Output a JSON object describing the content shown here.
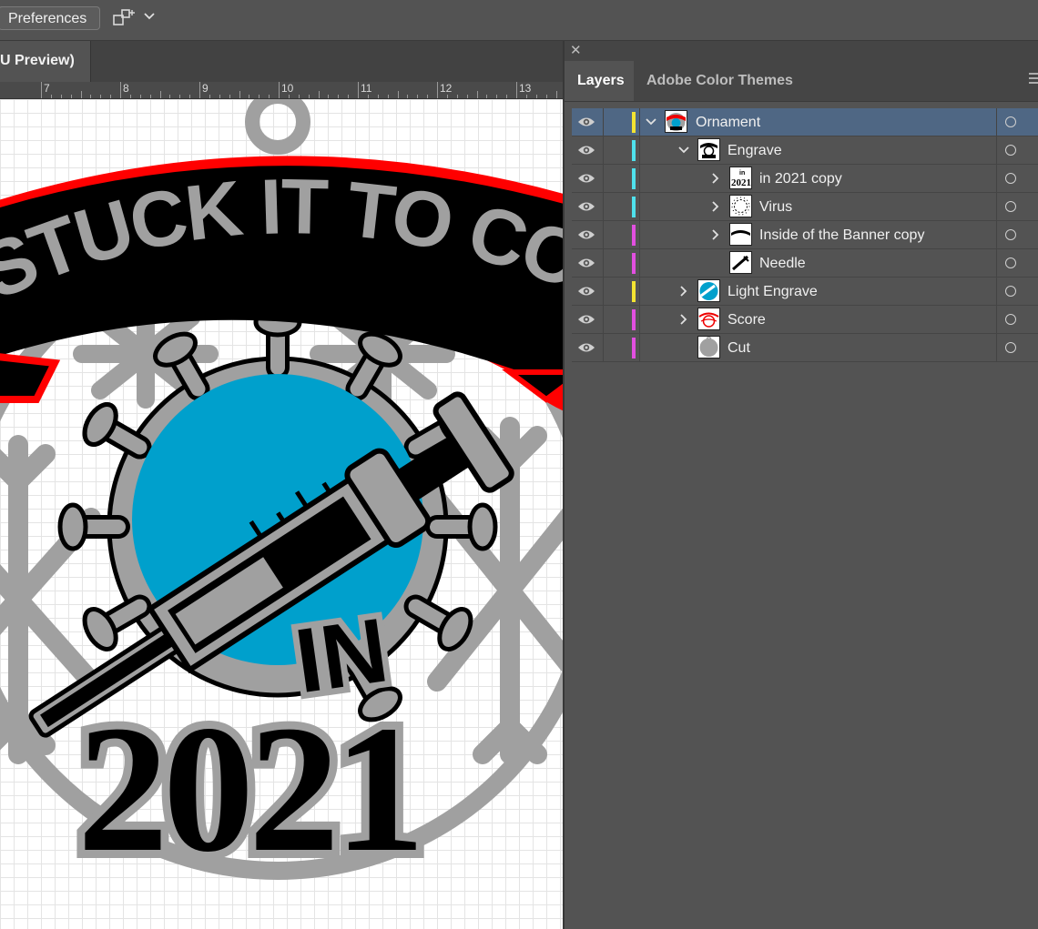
{
  "toolbar": {
    "preferences_label": "Preferences",
    "arrange_icon": "arrange-documents-icon",
    "dropdown_icon": "chevron-down-icon"
  },
  "document": {
    "tab_label": "U Preview)"
  },
  "ruler": {
    "labels": [
      "7",
      "8",
      "9",
      "10",
      "11",
      "12",
      "13"
    ]
  },
  "artwork": {
    "banner_text": "STUCK IT TO COVID",
    "in_text": "IN",
    "year_text": "2021",
    "colors": {
      "banner_red": "#ff0000",
      "banner_black": "#000000",
      "gray": "#a0a0a0",
      "circle_blue": "#00a0cc"
    }
  },
  "panel": {
    "close_icon": "close-icon",
    "tabs": [
      {
        "label": "Layers",
        "active": true
      },
      {
        "label": "Adobe Color Themes",
        "active": false
      }
    ],
    "menu_icon": "panel-menu-icon",
    "layers": [
      {
        "name": "Ornament",
        "color": "#f3e332",
        "level": 0,
        "expanded": true,
        "has_children": true,
        "selected": true
      },
      {
        "name": "Engrave",
        "color": "#4fe1ec",
        "level": 1,
        "expanded": true,
        "has_children": true,
        "selected": false
      },
      {
        "name": "in 2021 copy",
        "color": "#4fe1ec",
        "level": 2,
        "expanded": false,
        "has_children": true,
        "selected": false
      },
      {
        "name": "Virus",
        "color": "#4fe1ec",
        "level": 2,
        "expanded": false,
        "has_children": true,
        "selected": false
      },
      {
        "name": "Inside of the Banner copy",
        "color": "#e24fe0",
        "level": 2,
        "expanded": false,
        "has_children": true,
        "selected": false
      },
      {
        "name": "Needle",
        "color": "#e24fe0",
        "level": 2,
        "expanded": false,
        "has_children": false,
        "selected": false
      },
      {
        "name": "Light Engrave",
        "color": "#f3e332",
        "level": 1,
        "expanded": false,
        "has_children": true,
        "selected": false
      },
      {
        "name": "Score",
        "color": "#e24fe0",
        "level": 1,
        "expanded": false,
        "has_children": true,
        "selected": false
      },
      {
        "name": "Cut",
        "color": "#e24fe0",
        "level": 1,
        "expanded": false,
        "has_children": false,
        "selected": false
      }
    ]
  }
}
